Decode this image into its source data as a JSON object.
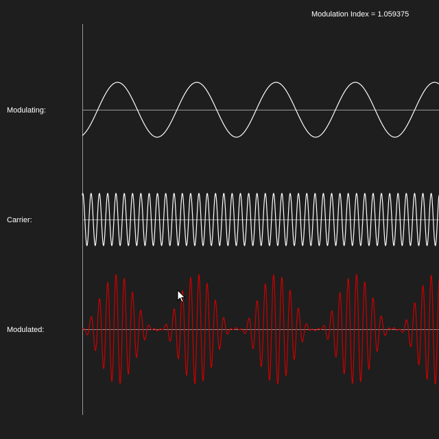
{
  "header": {
    "modulation_index_label": "Modulation Index = 1.059375"
  },
  "rows": {
    "modulating_label": "Modulating:",
    "carrier_label": "Carrier:",
    "modulated_label": "Modulated:"
  },
  "colors": {
    "background": "#1e1e1e",
    "signal": "#ffffff",
    "modulated": "#cc0000",
    "axis": "#9a9a9a"
  },
  "icons": {
    "pointer": "cursor-arrow-icon"
  },
  "chart_data": {
    "type": "line",
    "series": [
      {
        "name": "Modulating",
        "cycles": 4.5,
        "amplitude": 1.0,
        "phase": "trough-start"
      },
      {
        "name": "Carrier",
        "cycles": 43,
        "amplitude": 1.0
      },
      {
        "name": "Modulated",
        "modulation_index": 1.059375,
        "envelope_cycles": 4.5,
        "carrier_cycles": 43
      }
    ]
  }
}
